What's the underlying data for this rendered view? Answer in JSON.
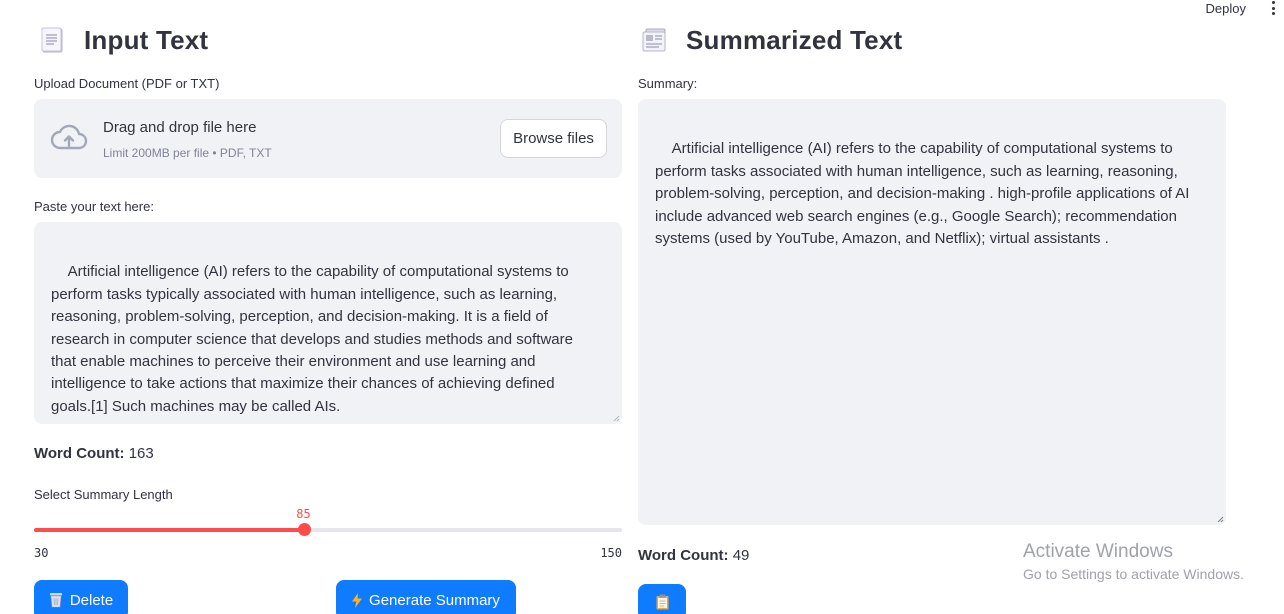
{
  "topbar": {
    "deploy_label": "Deploy",
    "menu_icon": "kebab-menu-icon"
  },
  "input_panel": {
    "title": "Input Text",
    "icon": "page-facing-up-icon",
    "upload": {
      "label": "Upload Document (PDF or TXT)",
      "drop_text": "Drag and drop file here",
      "limit_text": "Limit 200MB per file • PDF, TXT",
      "browse_label": "Browse files",
      "icon": "cloud-upload-icon"
    },
    "paste_label": "Paste your text here:",
    "text": "Artificial intelligence (AI) refers to the capability of computational systems to perform tasks typically associated with human intelligence, such as learning, reasoning, problem-solving, perception, and decision-making. It is a field of research in computer science that develops and studies methods and software that enable machines to perceive their environment and use learning and intelligence to take actions that maximize their chances of achieving defined goals.[1] Such machines may be called AIs.",
    "word_count_label": "Word Count:",
    "word_count": "163",
    "slider": {
      "label": "Select Summary Length",
      "min": 30,
      "max": 150,
      "value": 85,
      "min_label": "30",
      "max_label": "150",
      "value_label": "85",
      "accent": "#ff4b4b"
    },
    "delete_label": "Delete",
    "delete_icon": "wastebasket-icon",
    "generate_label": "Generate Summary",
    "generate_icon": "lightning-icon"
  },
  "summary_panel": {
    "title": "Summarized Text",
    "icon": "newspaper-icon",
    "summary_label": "Summary:",
    "text": "Artificial intelligence (AI) refers to the capability of computational systems to perform tasks associated with human intelligence, such as learning, reasoning, problem-solving, perception, and decision-making . high-profile applications of AI include advanced web search engines (e.g., Google Search); recommendation systems (used by YouTube, Amazon, and Netflix); virtual assistants .",
    "word_count_label": "Word Count:",
    "word_count": "49",
    "copy_icon": "clipboard-icon"
  },
  "watermark": {
    "line1": "Activate Windows",
    "line2": "Go to Settings to activate Windows."
  },
  "colors": {
    "primary_button": "#0f7bff",
    "panel_bg": "#f0f2f6",
    "text": "#31333f"
  }
}
